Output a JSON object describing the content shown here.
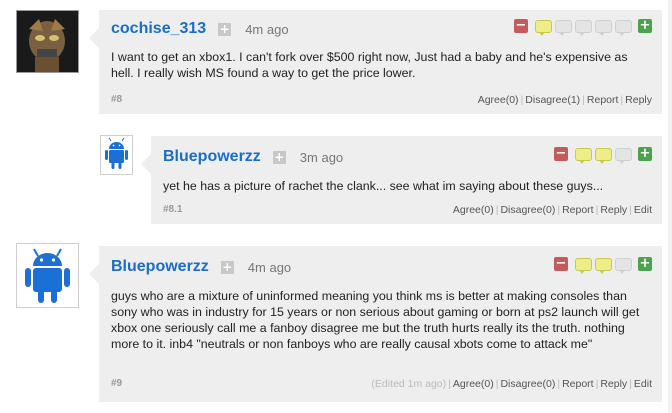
{
  "comments": [
    {
      "username": "cochise_313",
      "follow": "+",
      "time": "4m ago",
      "text": "I want to get an xbox1. I can't fork over $500 right now, Just had a baby and he's expensive as hell. I really wish MS found a way to get the price lower.",
      "number": "#8",
      "rating_bubbles_on": 1,
      "actions": {
        "agree": "Agree(0)",
        "disagree": "Disagree(1)",
        "report": "Report",
        "reply": "Reply"
      }
    },
    {
      "username": "Bluepowerzz",
      "follow": "+",
      "time": "3m ago",
      "text": "yet he has a picture of rachet the clank... see what im saying about these guys...",
      "number": "#8.1",
      "rating_bubbles_on": 2,
      "actions": {
        "agree": "Agree(0)",
        "disagree": "Disagree(0)",
        "report": "Report",
        "reply": "Reply",
        "edit": "Edit"
      }
    },
    {
      "username": "Bluepowerzz",
      "follow": "+",
      "time": "4m ago",
      "text": "guys who are a mixture of uninformed meaning you think ms is better at making consoles than sony who was in industry for 15 years or non serious about gaming or born at ps2 launch will get xbox one seriously call me a fanboy disagree me but the truth hurts really its the truth. nothing more to it. inb4 \"neutrals or non fanboys who are really causal xbots come to attack me\"",
      "number": "#9",
      "edited": "(Edited 1m ago)",
      "rating_bubbles_on": 2,
      "actions": {
        "agree": "Agree(0)",
        "disagree": "Disagree(0)",
        "report": "Report",
        "reply": "Reply",
        "edit": "Edit"
      }
    }
  ],
  "rating": {
    "minus": "−",
    "plus": "+"
  },
  "colors": {
    "username": "#1a6ec8",
    "bubble_bg": "#eeeeee",
    "minus": "#c65a5a",
    "plus": "#4aa54a",
    "rated": "#eeee88"
  }
}
